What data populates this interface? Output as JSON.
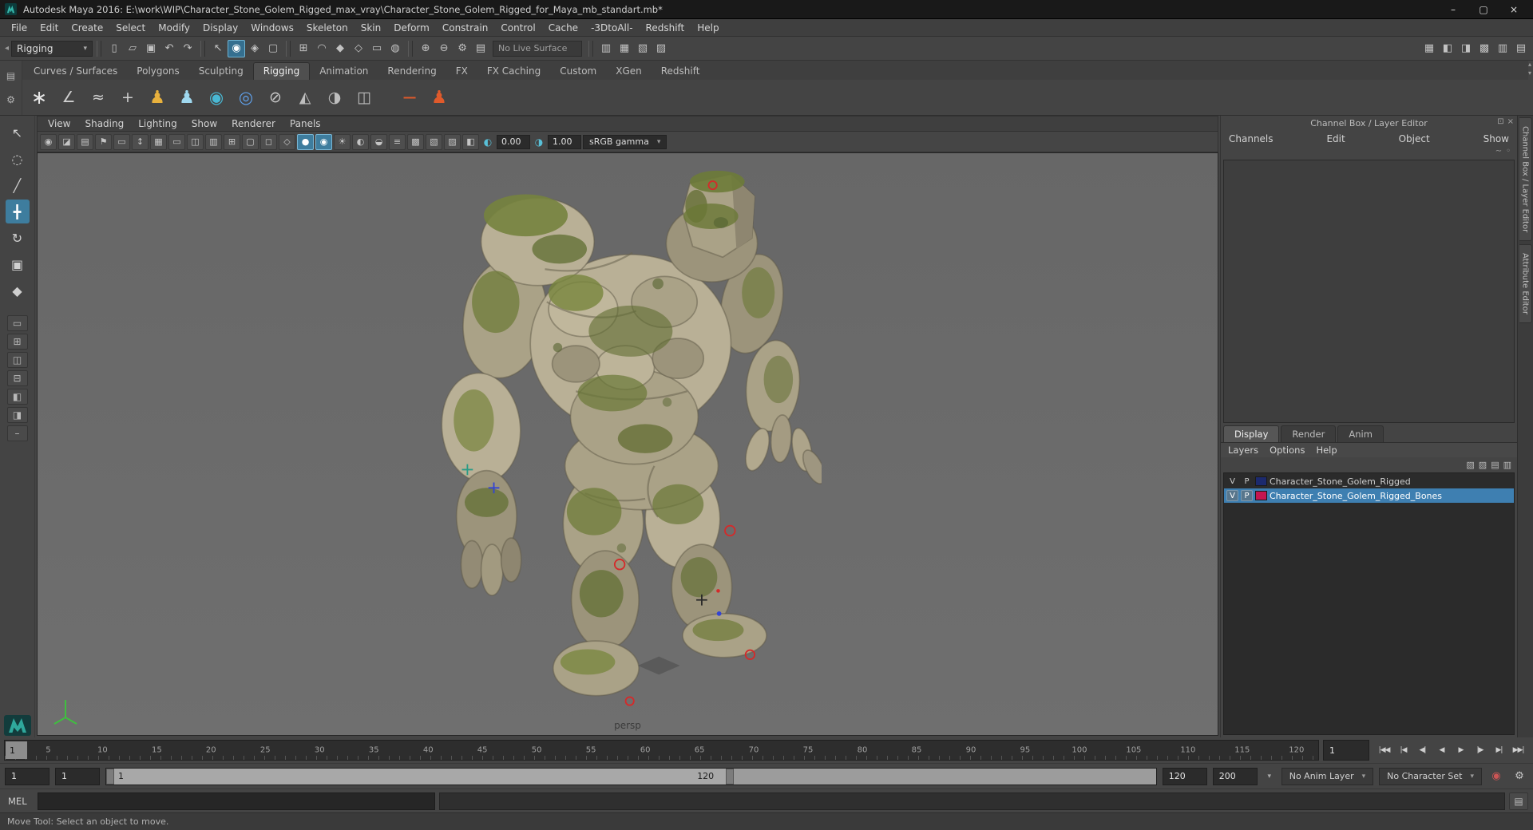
{
  "titlebar": {
    "title": "Autodesk Maya 2016: E:\\work\\WIP\\Character_Stone_Golem_Rigged_max_vray\\Character_Stone_Golem_Rigged_for_Maya_mb_standart.mb*",
    "minimize": "–",
    "maximize": "▢",
    "close": "×"
  },
  "menubar": {
    "items": [
      "File",
      "Edit",
      "Create",
      "Select",
      "Modify",
      "Display",
      "Windows",
      "Skeleton",
      "Skin",
      "Deform",
      "Constrain",
      "Control",
      "Cache",
      "-3DtoAll-",
      "Redshift",
      "Help"
    ]
  },
  "statusline": {
    "mode": "Rigging",
    "caret": "▾",
    "collapse": "◂",
    "live_surface": "No Live Surface",
    "file_icons": [
      {
        "name": "new-scene-icon",
        "glyph": "▯"
      },
      {
        "name": "open-scene-icon",
        "glyph": "▱"
      },
      {
        "name": "save-scene-icon",
        "glyph": "▣"
      },
      {
        "name": "undo-icon",
        "glyph": "↶"
      },
      {
        "name": "redo-icon",
        "glyph": "↷"
      }
    ],
    "selection_icons": [
      {
        "name": "select-hierarchy-mode-icon",
        "glyph": "↖"
      },
      {
        "name": "select-object-mode-icon",
        "glyph": "◉",
        "active": true
      },
      {
        "name": "select-component-mode-icon",
        "glyph": "◈"
      },
      {
        "name": "highlight-selection-mode-icon",
        "glyph": "▢"
      }
    ],
    "snap_icons": [
      {
        "name": "snap-to-grids-icon",
        "glyph": "⊞"
      },
      {
        "name": "snap-to-curves-icon",
        "glyph": "◠"
      },
      {
        "name": "snap-to-points-icon",
        "glyph": "◆"
      },
      {
        "name": "snap-to-projected-center-icon",
        "glyph": "◇"
      },
      {
        "name": "snap-to-view-planes-icon",
        "glyph": "▭"
      },
      {
        "name": "make-live-icon",
        "glyph": "◍"
      }
    ],
    "history_icons": [
      {
        "name": "inputs-operations-icon",
        "glyph": "⊕"
      },
      {
        "name": "outputs-operations-icon",
        "glyph": "⊖"
      },
      {
        "name": "construction-history-icon",
        "glyph": "⚙"
      },
      {
        "name": "keyable-attributes-icon",
        "glyph": "▤"
      }
    ],
    "render_icons": [
      {
        "name": "open-render-view-icon",
        "glyph": "▥"
      },
      {
        "name": "render-current-frame-icon",
        "glyph": "▦"
      },
      {
        "name": "ipr-render-icon",
        "glyph": "▧"
      },
      {
        "name": "render-settings-icon",
        "glyph": "▨"
      }
    ],
    "right_icons": [
      {
        "name": "grid-toggle-icon",
        "glyph": "▦"
      },
      {
        "name": "modeling-toolkit-toggle-icon",
        "glyph": "◧"
      },
      {
        "name": "humanik-toggle-icon",
        "glyph": "◨"
      },
      {
        "name": "tool-settings-toggle-icon",
        "glyph": "▩"
      },
      {
        "name": "attribute-editor-toggle-icon",
        "glyph": "▥"
      },
      {
        "name": "channel-box-toggle-icon",
        "glyph": "▤"
      }
    ]
  },
  "shelf": {
    "menu_icon": "▤",
    "gear_icon": "⚙",
    "scroll_up": "▴",
    "scroll_down": "▾",
    "tabs": [
      {
        "label": "Curves / Surfaces"
      },
      {
        "label": "Polygons"
      },
      {
        "label": "Sculpting"
      },
      {
        "label": "Rigging",
        "active": true
      },
      {
        "label": "Animation"
      },
      {
        "label": "Rendering"
      },
      {
        "label": "FX"
      },
      {
        "label": "FX Caching"
      },
      {
        "label": "Custom"
      },
      {
        "label": "XGen"
      },
      {
        "label": "Redshift"
      }
    ],
    "icons": [
      {
        "name": "joint-tool-icon",
        "glyph": "∗",
        "style": "color:#e8e8e8;font-size:24px"
      },
      {
        "name": "ik-handle-tool-icon",
        "glyph": "∠",
        "style": "color:#cfcfcf"
      },
      {
        "name": "ik-spline-handle-tool-icon",
        "glyph": "≈",
        "style": "color:#cfcfcf"
      },
      {
        "name": "insert-joint-tool-icon",
        "glyph": "+",
        "style": "color:#cfcfcf"
      },
      {
        "name": "create-character-icon",
        "glyph": "♟",
        "style": "color:#e8b13d;font-size:22px"
      },
      {
        "name": "define-character-icon",
        "glyph": "♟",
        "style": "color:#9fd8ef;font-size:22px"
      },
      {
        "name": "bind-skin-icon",
        "glyph": "◉",
        "style": "color:#49b8d4;font-size:21px"
      },
      {
        "name": "interactive-bind-skin-icon",
        "glyph": "◎",
        "style": "color:#5f9fe8;font-size:21px"
      },
      {
        "name": "detach-skin-icon",
        "glyph": "⊘",
        "style": "color:#c9c9c9"
      },
      {
        "name": "paint-skin-weights-icon",
        "glyph": "◭",
        "style": "color:#bdbdbd"
      },
      {
        "name": "mirror-skin-weights-icon",
        "glyph": "◑",
        "style": "color:#bdbdbd"
      },
      {
        "name": "copy-skin-weights-icon",
        "glyph": "◫",
        "style": "color:#bdbdbd"
      },
      {
        "name": "parent-constraint-icon",
        "glyph": "−",
        "style": "margin-left:20px;color:#e05a2b;font-size:24px"
      },
      {
        "name": "humanik-window-icon",
        "glyph": "♟",
        "style": "color:#e05a2b;font-size:22px"
      }
    ]
  },
  "toolbox": {
    "tools": [
      {
        "name": "select-tool-icon",
        "glyph": "↖"
      },
      {
        "name": "lasso-tool-icon",
        "glyph": "◌"
      },
      {
        "name": "paint-select-tool-icon",
        "glyph": "╱"
      },
      {
        "name": "move-tool-icon",
        "glyph": "╋",
        "active": true
      },
      {
        "name": "rotate-tool-icon",
        "glyph": "↻"
      },
      {
        "name": "scale-tool-icon",
        "glyph": "▣"
      },
      {
        "name": "last-tool-icon",
        "glyph": "◆"
      }
    ],
    "layouts": [
      {
        "name": "single-pane-layout-icon",
        "glyph": "▭"
      },
      {
        "name": "four-pane-layout-icon",
        "glyph": "⊞"
      },
      {
        "name": "two-pane-side-layout-icon",
        "glyph": "◫"
      },
      {
        "name": "two-pane-stacked-layout-icon",
        "glyph": "⊟"
      },
      {
        "name": "persp-outliner-layout-icon",
        "glyph": "◧"
      },
      {
        "name": "hypershade-persp-layout-icon",
        "glyph": "◨"
      },
      {
        "name": "collapse-layouts-icon",
        "glyph": "–"
      }
    ]
  },
  "viewport": {
    "menus": [
      "View",
      "Shading",
      "Lighting",
      "Show",
      "Renderer",
      "Panels"
    ],
    "icons": [
      {
        "name": "select-camera-icon",
        "glyph": "◉"
      },
      {
        "name": "lock-camera-icon",
        "glyph": "◪"
      },
      {
        "name": "camera-attributes-icon",
        "glyph": "▤"
      },
      {
        "name": "bookmarks-icon",
        "glyph": "⚑"
      },
      {
        "name": "image-plane-icon",
        "glyph": "▭"
      },
      {
        "name": "2d-pan-zoom-icon",
        "glyph": "↕"
      },
      {
        "name": "grid-display-icon",
        "glyph": "▦"
      },
      {
        "name": "film-gate-icon",
        "glyph": "▭"
      },
      {
        "name": "resolution-gate-icon",
        "glyph": "◫"
      },
      {
        "name": "gate-mask-icon",
        "glyph": "▥"
      },
      {
        "name": "field-chart-icon",
        "glyph": "⊞"
      },
      {
        "name": "safe-action-icon",
        "glyph": "▢"
      },
      {
        "name": "safe-title-icon",
        "glyph": "◻"
      },
      {
        "name": "wireframe-mode-icon",
        "glyph": "◇"
      },
      {
        "name": "shaded-mode-icon",
        "glyph": "●",
        "active": true
      },
      {
        "name": "textured-mode-icon",
        "glyph": "◉",
        "active": true
      },
      {
        "name": "use-all-lights-icon",
        "glyph": "☀"
      },
      {
        "name": "shadows-icon",
        "glyph": "◐"
      },
      {
        "name": "screen-space-ao-icon",
        "glyph": "◒"
      },
      {
        "name": "motion-blur-icon",
        "glyph": "≡"
      },
      {
        "name": "multisample-aa-icon",
        "glyph": "▩"
      },
      {
        "name": "xray-icon",
        "glyph": "▧"
      },
      {
        "name": "xray-joints-icon",
        "glyph": "▨"
      },
      {
        "name": "isolate-select-icon",
        "glyph": "◧"
      }
    ],
    "exposure_icon": "◐",
    "exposure": "0.00",
    "gamma_icon": "◑",
    "gamma": "1.00",
    "colorspace": "sRGB gamma",
    "colorspace_caret": "▾",
    "camera_label": "persp"
  },
  "channel_box": {
    "title": "Channel Box / Layer Editor",
    "header_icons": [
      {
        "name": "dock-channel-box-icon",
        "glyph": "⊡"
      },
      {
        "name": "close-channel-box-icon",
        "glyph": "×"
      }
    ],
    "menus": [
      "Channels",
      "Edit",
      "Object",
      "Show"
    ],
    "mini_icons": [
      {
        "name": "channel-slider-speed-icon",
        "glyph": "∼"
      },
      {
        "name": "channel-manip-icon",
        "glyph": "◦"
      }
    ],
    "layer_tabs": [
      {
        "label": "Display",
        "active": true
      },
      {
        "label": "Render"
      },
      {
        "label": "Anim"
      }
    ],
    "layer_menus": [
      "Layers",
      "Options",
      "Help"
    ],
    "layer_icons": [
      {
        "name": "move-layer-up-icon",
        "glyph": "▧"
      },
      {
        "name": "move-layer-down-icon",
        "glyph": "▨"
      },
      {
        "name": "new-empty-layer-icon",
        "glyph": "▤"
      },
      {
        "name": "new-layer-from-selected-icon",
        "glyph": "▥"
      }
    ],
    "layers": [
      {
        "v": "V",
        "p": "P",
        "name": "Character_Stone_Golem_Rigged",
        "swatch_style": "background:#1c2a6e"
      },
      {
        "v": "V",
        "p": "P",
        "name": "Character_Stone_Golem_Rigged_Bones",
        "swatch_style": "background:#c41650",
        "selected": true
      }
    ]
  },
  "side_tabs": [
    "Channel Box / Layer Editor",
    "Attribute Editor"
  ],
  "timeline": {
    "current_frame": "1",
    "frame_field": "1",
    "ticks": [
      {
        "label": "5"
      },
      {
        "label": "10"
      },
      {
        "label": "15"
      },
      {
        "label": "20"
      },
      {
        "label": "25"
      },
      {
        "label": "30"
      },
      {
        "label": "35"
      },
      {
        "label": "40"
      },
      {
        "label": "45"
      },
      {
        "label": "50"
      },
      {
        "label": "55"
      },
      {
        "label": "60"
      },
      {
        "label": "65"
      },
      {
        "label": "70"
      },
      {
        "label": "75"
      },
      {
        "label": "80"
      },
      {
        "label": "85"
      },
      {
        "label": "90"
      },
      {
        "label": "95"
      },
      {
        "label": "100"
      },
      {
        "label": "105"
      },
      {
        "label": "110"
      },
      {
        "label": "115"
      },
      {
        "label": "120"
      }
    ],
    "playback": [
      {
        "name": "go-to-start-button",
        "glyph": "|◀◀"
      },
      {
        "name": "step-back-key-button",
        "glyph": "|◀"
      },
      {
        "name": "step-back-frame-button",
        "glyph": "◀|"
      },
      {
        "name": "play-backwards-button",
        "glyph": "◀"
      },
      {
        "name": "play-forwards-button",
        "glyph": "▶"
      },
      {
        "name": "step-forward-frame-button",
        "glyph": "|▶"
      },
      {
        "name": "step-forward-key-button",
        "glyph": "▶|"
      },
      {
        "name": "go-to-end-button",
        "glyph": "▶▶|"
      }
    ]
  },
  "range_slider": {
    "animation_start": "1",
    "playback_start": "1",
    "range_start_label": "1",
    "range_end_label": "120",
    "playback_end": "120",
    "animation_end": "200",
    "options_caret": "▾",
    "anim_layer": "No Anim Layer",
    "character_set": "No Character Set",
    "autokey_icon": "◉",
    "prefs_icon": "⚙"
  },
  "command_line": {
    "label": "MEL",
    "input": "",
    "result": ""
  },
  "help_line": {
    "text": "Move Tool: Select an object to move."
  },
  "colors": {
    "accent": "#5285a6",
    "selection": "#3e7fb1",
    "viewport_bg": "#6b6b6b",
    "layer1_swatch": "#1c2a6e",
    "layer2_swatch": "#c41650"
  }
}
